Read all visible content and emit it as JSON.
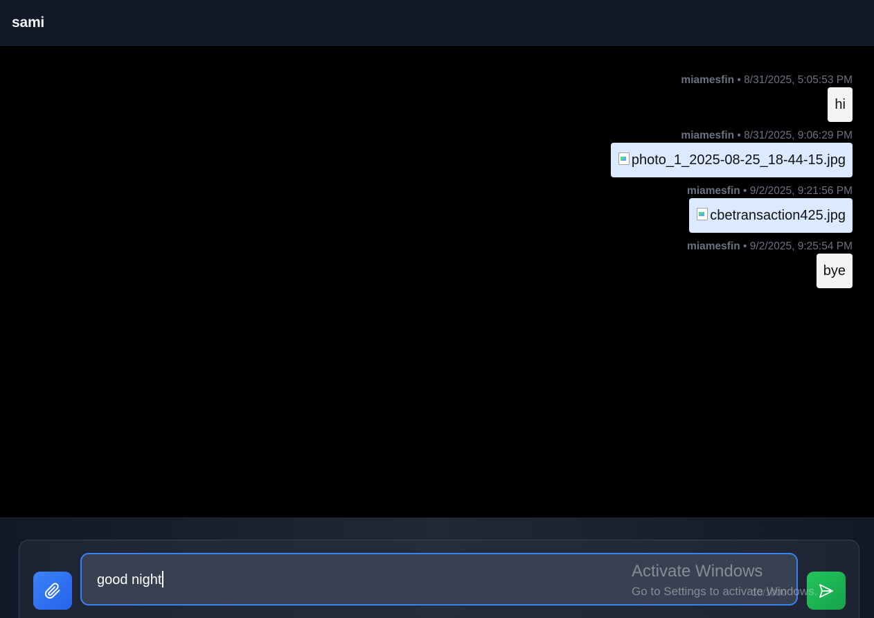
{
  "header": {
    "title": "sami"
  },
  "messages": [
    {
      "sender": "miamesfin",
      "separator": "•",
      "timestamp": "8/31/2025, 5:05:53 PM",
      "type": "text",
      "content": "hi"
    },
    {
      "sender": "miamesfin",
      "separator": "•",
      "timestamp": "8/31/2025, 9:06:29 PM",
      "type": "file",
      "content": "photo_1_2025-08-25_18-44-15.jpg"
    },
    {
      "sender": "miamesfin",
      "separator": "•",
      "timestamp": "9/2/2025, 9:21:56 PM",
      "type": "file",
      "content": "cbetransaction425.jpg"
    },
    {
      "sender": "miamesfin",
      "separator": "•",
      "timestamp": "9/2/2025, 9:25:54 PM",
      "type": "text",
      "content": "bye"
    }
  ],
  "composer": {
    "input_value": "good night",
    "char_counter": "10/1000",
    "attach_icon": "paperclip-icon",
    "send_icon": "send-icon"
  },
  "watermark": {
    "title": "Activate Windows",
    "subtitle": "Go to Settings to activate Windows."
  },
  "colors": {
    "header_bg": "#111827",
    "chat_bg": "#000000",
    "text_bubble": "#f3f4f6",
    "file_bubble": "#dbeafe",
    "attach_button": "#3b82f6",
    "send_button": "#22c55e",
    "input_border": "#3b82f6"
  }
}
